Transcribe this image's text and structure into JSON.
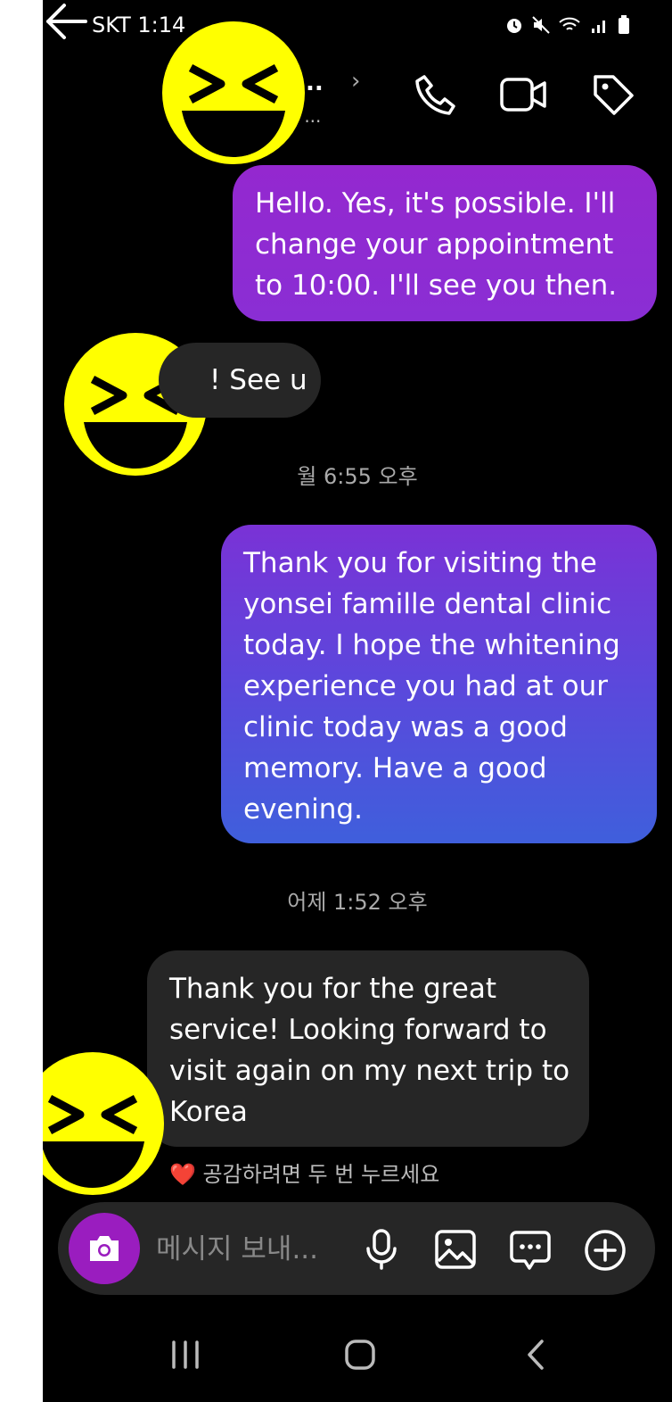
{
  "status_bar": {
    "carrier_time": "SKT  1:14"
  },
  "header": {
    "contact_name": "Y...i...",
    "contact_status": "완료",
    "contact_status_extra": " • ..."
  },
  "messages": [
    {
      "side": "out",
      "text": "Hello. Yes, it's possible. I'll change your appointment to 10:00. I'll see you then."
    },
    {
      "side": "in",
      "text": "! See u"
    },
    {
      "timestamp": "월 6:55 오후"
    },
    {
      "side": "out",
      "text": "Thank you for visiting the yonsei famille dental clinic today. I hope the whitening experience you had at our clinic today was a good memory. Have a good evening."
    },
    {
      "timestamp": "어제 1:52 오후"
    },
    {
      "side": "in",
      "text": "Thank you for the great service! Looking forward to visit again on my next trip to Korea"
    }
  ],
  "reaction_hint": "❤️ 공감하려면 두 번 누르세요",
  "composer": {
    "placeholder": "메시지 보내..."
  },
  "colors": {
    "accent_purple": "#9a1dbf",
    "online_green": "#32c16c",
    "emoji_yellow": "#ffff00"
  },
  "icons": [
    "back-arrow-icon",
    "phone-icon",
    "video-icon",
    "tag-icon",
    "camera-icon",
    "microphone-icon",
    "gallery-icon",
    "sticker-icon",
    "plus-icon",
    "recent-apps-icon",
    "home-icon",
    "nav-back-icon"
  ]
}
